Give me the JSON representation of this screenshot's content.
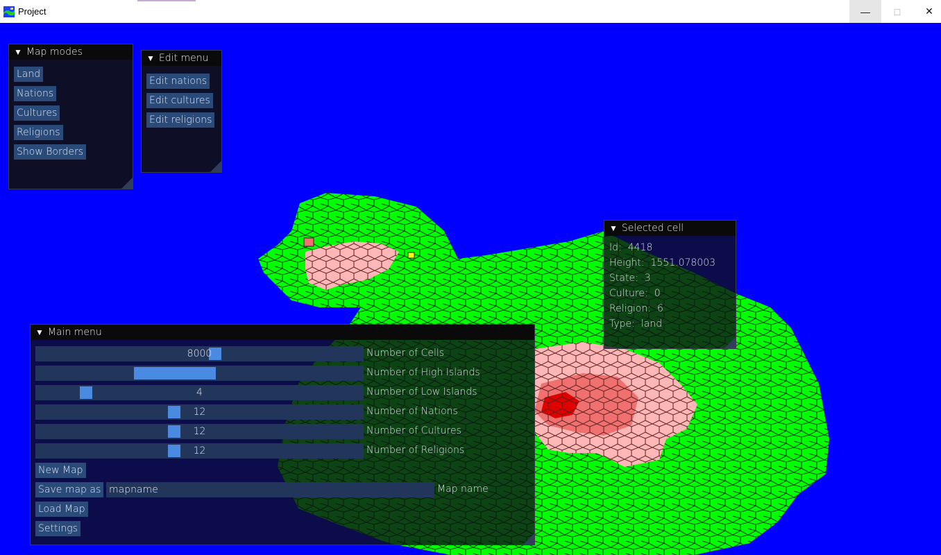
{
  "window": {
    "title": "Project",
    "min_icon": "minimize-icon",
    "max_icon": "maximize-icon",
    "close_icon": "close-icon"
  },
  "map_modes": {
    "title": "Map modes",
    "buttons": [
      "Land",
      "Nations",
      "Cultures",
      "Religions",
      "Show Borders"
    ]
  },
  "edit_menu": {
    "title": "Edit menu",
    "buttons": [
      "Edit nations",
      "Edit cultures",
      "Edit religions"
    ]
  },
  "selected_cell": {
    "title": "Selected cell",
    "rows": [
      {
        "key": "Id:",
        "value": "4418"
      },
      {
        "key": "Height:",
        "value": "1551.078003"
      },
      {
        "key": "State:",
        "value": "3"
      },
      {
        "key": "Culture:",
        "value": "0"
      },
      {
        "key": "Religion:",
        "value": "6"
      },
      {
        "key": "Type:",
        "value": "land"
      }
    ]
  },
  "main_menu": {
    "title": "Main menu",
    "sliders": [
      {
        "value": "8000",
        "label": "Number of Cells",
        "fraction": 0.55
      },
      {
        "value": "",
        "label": "Number of High Islands",
        "fraction": 0.4
      },
      {
        "value": "4",
        "label": "Number of Low Islands",
        "fraction": 0.14
      },
      {
        "value": "12",
        "label": "Number of Nations",
        "fraction": 0.42
      },
      {
        "value": "12",
        "label": "Number of Cultures",
        "fraction": 0.42
      },
      {
        "value": "12",
        "label": "Number of Religions",
        "fraction": 0.42
      }
    ],
    "new_map": "New Map",
    "save_map_as": "Save map as",
    "map_name_value": "mapname",
    "map_name_label": "Map name",
    "load_map": "Load Map",
    "settings": "Settings"
  },
  "colors": {
    "ocean": "#0000ff",
    "land": "#00ff00",
    "nation_light": "#ffb6b6",
    "nation_mid": "#f07070",
    "nation_dark": "#e00000",
    "highlight": "#ffff00"
  }
}
